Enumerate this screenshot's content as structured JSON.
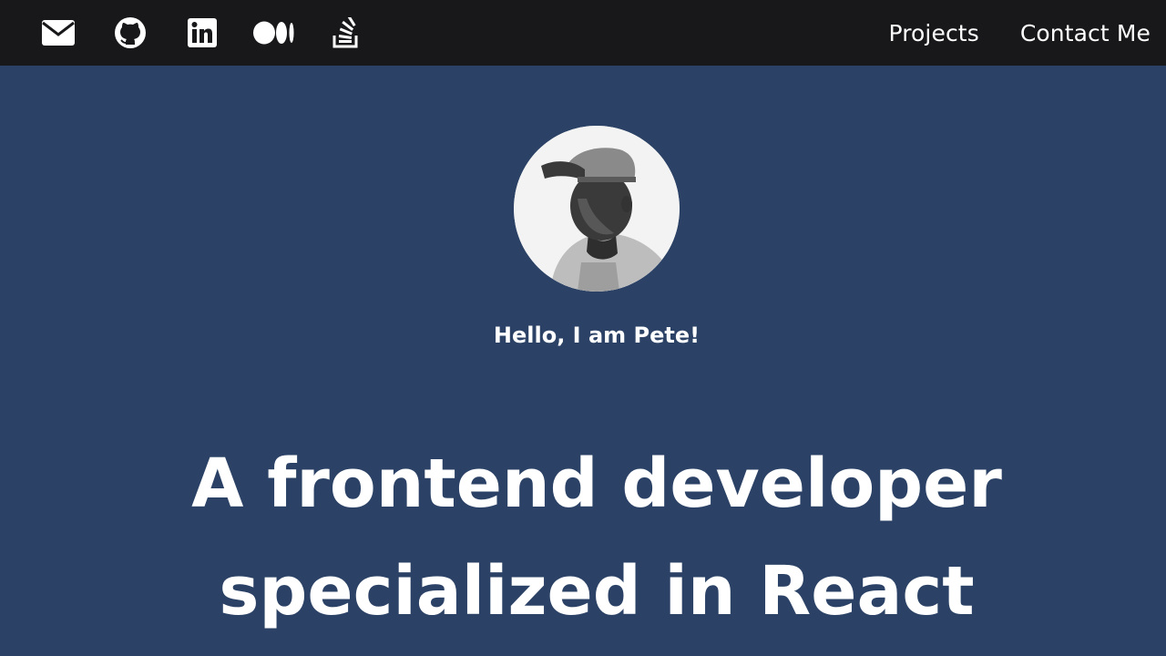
{
  "header": {
    "social_links": [
      {
        "icon": "envelope-icon",
        "name": "email-link"
      },
      {
        "icon": "github-icon",
        "name": "github-link"
      },
      {
        "icon": "linkedin-icon",
        "name": "linkedin-link"
      },
      {
        "icon": "medium-icon",
        "name": "medium-link"
      },
      {
        "icon": "stack-overflow-icon",
        "name": "stack-overflow-link"
      }
    ],
    "nav": {
      "projects_label": "Projects",
      "contact_label": "Contact Me"
    }
  },
  "hero": {
    "avatar_alt": "Pete",
    "greeting": "Hello, I am Pete!",
    "headline_line1": "A frontend developer",
    "headline_line2": "specialized in React"
  },
  "colors": {
    "header_bg": "#18181b",
    "hero_bg": "#2b4266",
    "text": "#ffffff"
  }
}
